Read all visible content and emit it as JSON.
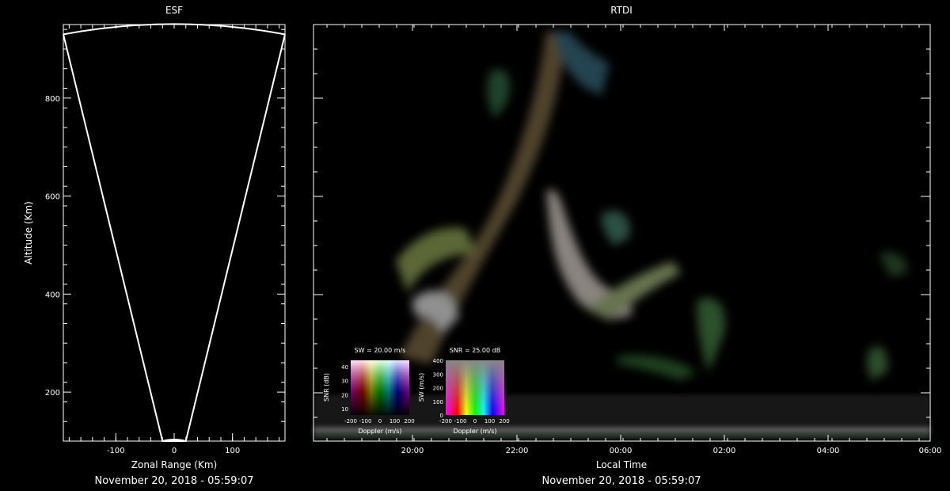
{
  "chart_data": [
    {
      "type": "line",
      "title": "ESF",
      "xlabel": "Zonal Range (Km)",
      "ylabel": "Altitude (Km)",
      "xlim": [
        -190,
        190
      ],
      "ylim": [
        100,
        950
      ],
      "x_ticks": [
        -100,
        0,
        100
      ],
      "y_ticks": [
        200,
        400,
        600,
        800
      ],
      "footer": "November 20, 2018 - 05:59:07",
      "series": [
        {
          "x": [
            -190,
            -20,
            20,
            190
          ],
          "y": [
            930,
            100,
            100,
            930
          ]
        }
      ],
      "grid": false
    },
    {
      "type": "heatmap",
      "title": "RTDI",
      "xlabel": "Local Time",
      "x_tick_labels": [
        "20:00",
        "22:00",
        "00:00",
        "02:00",
        "04:00",
        "06:00"
      ],
      "footer": "November 20, 2018 - 05:59:07",
      "grid": false,
      "legends": [
        {
          "title": "SW = 20.00 m/s",
          "xlabel": "Doppler (m/s)",
          "ylabel": "SNR (dB)",
          "x_tick_labels": [
            "-200",
            "-100",
            "0",
            "100",
            "200"
          ],
          "y_tick_labels": [
            "10",
            "20",
            "30",
            "40"
          ]
        },
        {
          "title": "SNR = 25.00 dB",
          "xlabel": "Doppler (m/s)",
          "ylabel": "SW (m/s)",
          "x_tick_labels": [
            "-200",
            "-100",
            "0",
            "100",
            "200"
          ],
          "y_tick_labels": [
            "0",
            "100",
            "200",
            "300",
            "400"
          ]
        }
      ]
    }
  ]
}
